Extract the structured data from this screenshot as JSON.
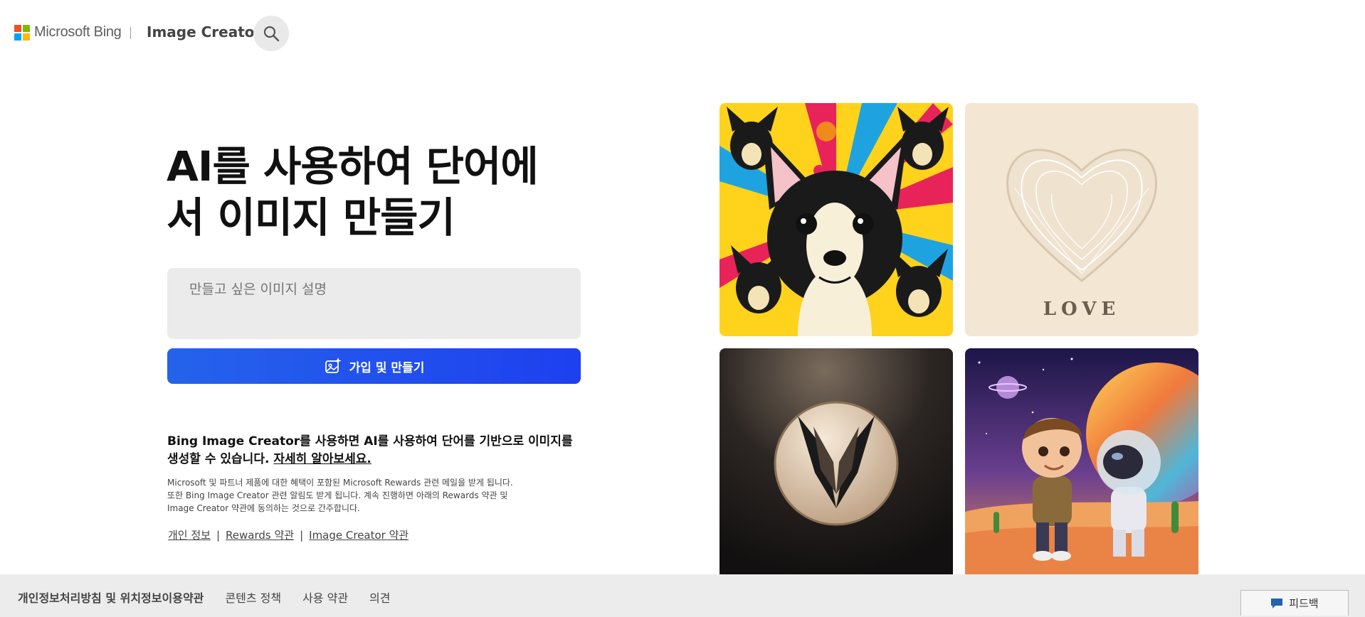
{
  "header": {
    "brand": "Microsoft Bing",
    "product": "Image Creator",
    "logo_colors": [
      "#f25022",
      "#7fba00",
      "#00a4ef",
      "#ffb900"
    ]
  },
  "hero": {
    "title_line1": "AI를 사용하여 단어에",
    "title_line2": "서 이미지 만들기"
  },
  "prompt": {
    "placeholder": "만들고 싶은 이미지 설명",
    "value": ""
  },
  "create_button": {
    "label": "가입 및 만들기",
    "color": "#2563eb"
  },
  "description": {
    "text": "Bing Image Creator를 사용하면 AI를 사용하여 단어를 기반으로 이미지를 생성할 수 있습니다. ",
    "link": "자세히 알아보세요."
  },
  "fine_print": {
    "line1": "Microsoft 및 파트너 제품에 대한 혜택이 포함된 Microsoft Rewards 관련 메일을 받게 됩니다.",
    "line2": "또한 Bing Image Creator 관련 알림도 받게 됩니다. 계속 진행하면 아래의 Rewards 약관 및",
    "line3": "Image Creator 약관에 동의하는 것으로 간주합니다."
  },
  "legal_links": [
    "개인 정보",
    "Rewards 약관",
    "Image Creator 약관"
  ],
  "gallery": {
    "love_text": "LOVE"
  },
  "footer": {
    "links": [
      "개인정보처리방침 및 위치정보이용약관",
      "콘텐츠 정책",
      "사용 약관",
      "의견"
    ],
    "feedback": "피드백"
  }
}
